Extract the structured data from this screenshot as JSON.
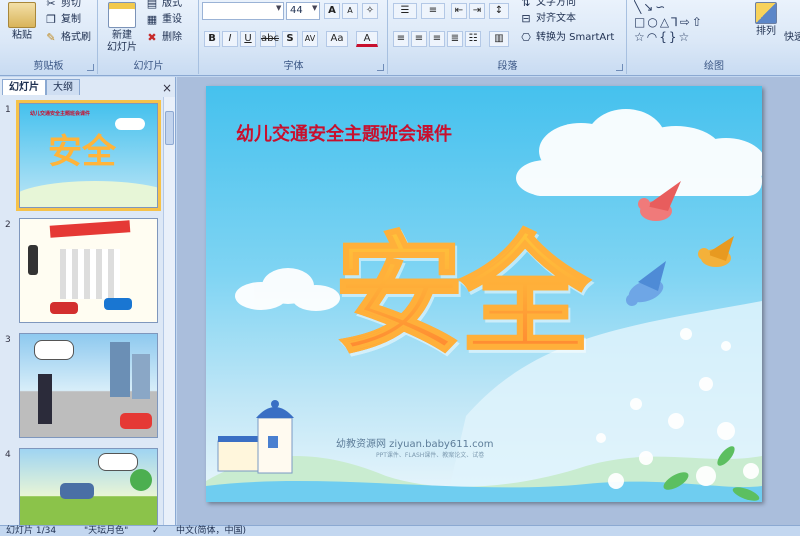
{
  "ribbon": {
    "clipboard": {
      "label": "剪贴板",
      "paste": "粘贴",
      "cut": "剪切",
      "copy": "复制",
      "format_painter": "格式刷"
    },
    "slides": {
      "label": "幻灯片",
      "new_slide_line1": "新建",
      "new_slide_line2": "幻灯片",
      "layout": "版式",
      "reset": "重设",
      "delete": "删除"
    },
    "font": {
      "label": "字体",
      "font_name": "",
      "font_size": "44"
    },
    "paragraph": {
      "label": "段落",
      "text_direction": "文字方向",
      "align_text": "对齐文本",
      "convert_smartart": "转换为 SmartArt"
    },
    "drawing": {
      "label": "绘图",
      "arrange": "排列",
      "quick_styles": "快速"
    }
  },
  "panel": {
    "tab_slides": "幻灯片",
    "tab_outline": "大纲",
    "close": "×",
    "thumbnails": [
      {
        "num": "1",
        "title": "幼儿交通安全主题班会课件",
        "big": "安全"
      },
      {
        "num": "2",
        "title": "",
        "big": ""
      },
      {
        "num": "3",
        "title": "",
        "big": ""
      },
      {
        "num": "4",
        "title": "",
        "big": ""
      }
    ]
  },
  "slide": {
    "title": "幼儿交通安全主题班会课件",
    "big_text": "安全",
    "watermark": "幼教资源网 ziyuan.baby611.com",
    "watermark_sub": "PPT课件、FLASH课件、教案论文、试卷"
  },
  "status": {
    "slide_count": "幻灯片 1/34",
    "theme": "\"天坛月色\"",
    "language": "中文(简体，中国)"
  }
}
